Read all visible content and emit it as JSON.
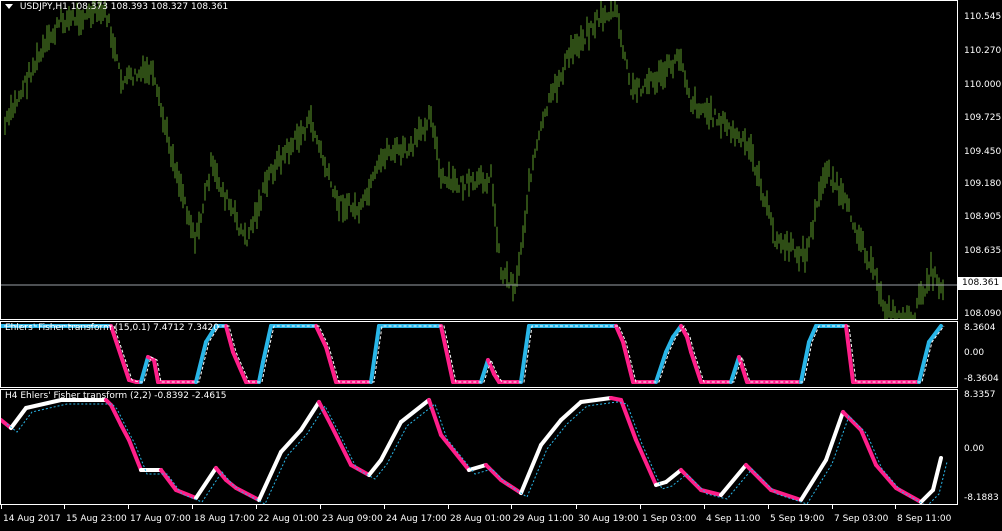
{
  "main": {
    "symbol_title": "USDJPY,H1",
    "ohlc": "108.373 108.393 108.327 108.361",
    "price_axis": [
      "110.545",
      "110.270",
      "110.000",
      "109.725",
      "109.450",
      "109.180",
      "108.905",
      "108.635",
      "108.090"
    ],
    "current_price": "108.361",
    "candle_color": "#5c9a2a"
  },
  "fisher1": {
    "title": "Ehlers' Fisher transform (15,0.1) 7.4712 7.3420",
    "axis": [
      "8.3604",
      "0.00",
      "-8.3604"
    ],
    "up_color": "#29b6e8",
    "down_color": "#ff1f8a"
  },
  "fisher2": {
    "title": "H4 Ehlers' Fisher transform (2,2) -0.8392 -2.4615",
    "axis": [
      "8.3357",
      "0.00",
      "-8.1883"
    ],
    "up_color": "#ffffff",
    "down_color": "#ff1f8a"
  },
  "time_axis": [
    "14 Aug 2017",
    "15 Aug 23:00",
    "17 Aug 07:00",
    "18 Aug 17:00",
    "22 Aug 01:00",
    "23 Aug 09:00",
    "24 Aug 17:00",
    "28 Aug 01:00",
    "29 Aug 11:00",
    "30 Aug 19:00",
    "1 Sep 03:00",
    "4 Sep 11:00",
    "5 Sep 19:00",
    "7 Sep 03:00",
    "8 Sep 11:00"
  ],
  "icons": {
    "menu": "dropdown-triangle-icon"
  }
}
